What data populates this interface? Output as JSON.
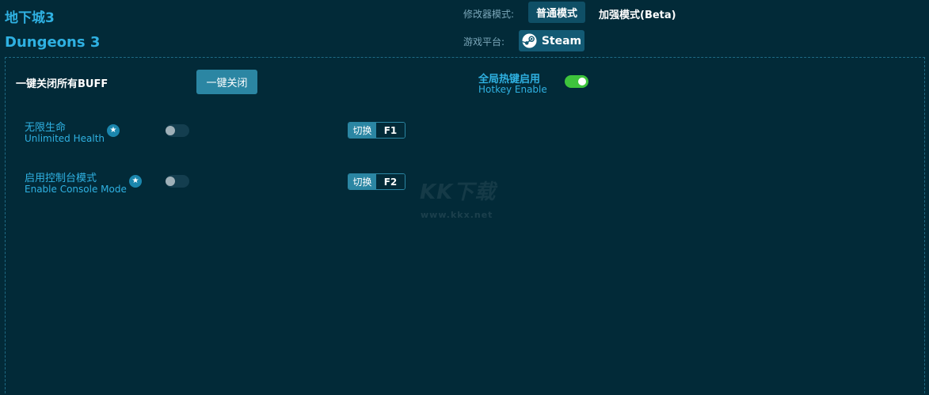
{
  "header": {
    "title_cn": "地下城3",
    "title_en": "Dungeons 3",
    "mode_label": "修改器模式:",
    "mode_normal": "普通模式",
    "mode_enhanced": "加强模式(Beta)",
    "platform_label": "游戏平台:",
    "platform_name": "Steam"
  },
  "toolbar": {
    "buff_label": "一键关闭所有BUFF",
    "close_button": "一键关闭",
    "hotkey_cn": "全局热键启用",
    "hotkey_en": "Hotkey Enable",
    "hotkey_enabled": true
  },
  "cheats": [
    {
      "name_cn": "无限生命",
      "name_en": "Unlimited Health",
      "enabled": false,
      "action": "切换",
      "key": "F1"
    },
    {
      "name_cn": "启用控制台模式",
      "name_en": "Enable Console Mode",
      "enabled": false,
      "action": "切换",
      "key": "F2"
    }
  ],
  "watermark": {
    "logo": "KK下载",
    "url": "www.kkx.net"
  },
  "colors": {
    "background": "#022a38",
    "accent": "#2fb1e2",
    "button": "#2b86a3",
    "toggle_on": "#3ec43c"
  }
}
